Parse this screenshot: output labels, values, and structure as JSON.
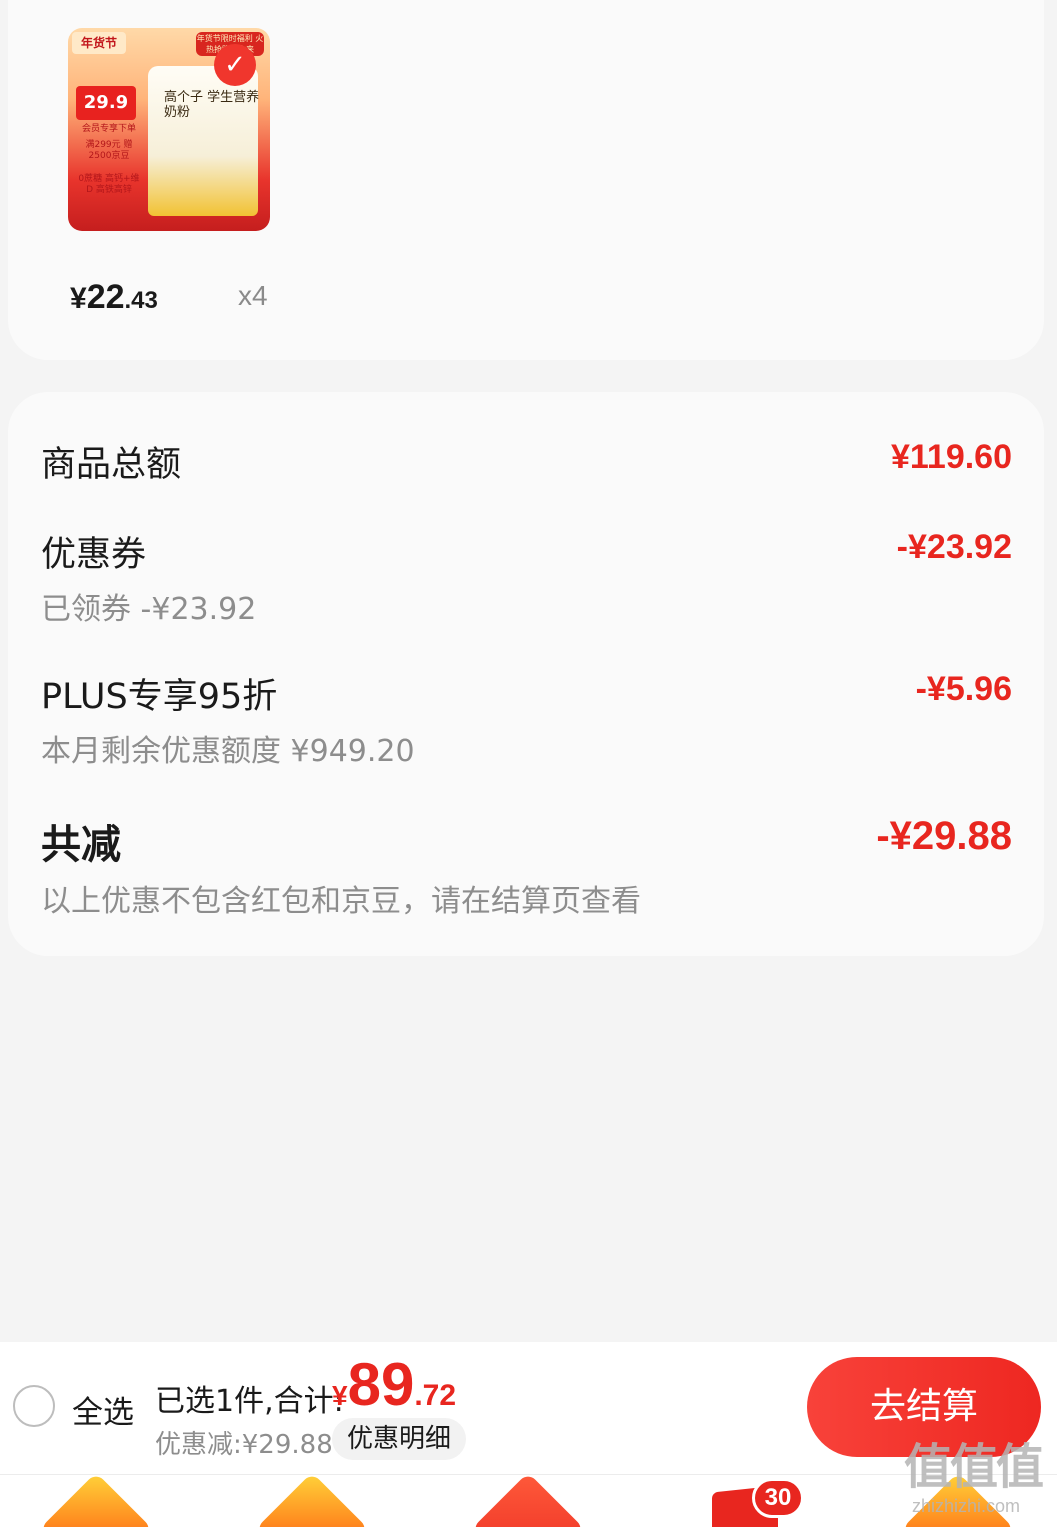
{
  "product": {
    "image_banner": "年货节限时福利 火热抢购等你来",
    "image_logo": "年货节",
    "image_price_tag": "29.9",
    "image_tag_member": "会员专享下单",
    "image_tag_beans": "满299元 赠2500京豆",
    "image_tag_features": "0蔗糖 高钙+维D 高铁高锌",
    "image_bag_title": "高个子 学生营养奶粉",
    "unit_price_symbol": "¥",
    "unit_price_int": "22",
    "unit_price_dec": ".43",
    "quantity": "x4"
  },
  "summary": {
    "goods_total_label": "商品总额",
    "goods_total_amount": "¥119.60",
    "coupon_label": "优惠券",
    "coupon_sub": "已领券 -¥23.92",
    "coupon_amount": "-¥23.92",
    "plus_label": "PLUS专享95折",
    "plus_sub": "本月剩余优惠额度 ¥949.20",
    "plus_amount": "-¥5.96",
    "total_reduce_label": "共减",
    "total_reduce_amount": "-¥29.88",
    "note": "以上优惠不包含红包和京豆，请在结算页查看"
  },
  "checkout": {
    "select_all_label": "全选",
    "selected_summary": "已选1件,合计:",
    "total_symbol": "¥",
    "total_int": "89",
    "total_dec": ".72",
    "discount_line": "优惠减:¥29.88",
    "discount_detail_label": "优惠明细",
    "checkout_label": "去结算"
  },
  "tab_bar": {
    "cart_badge": "30"
  },
  "watermark": {
    "big": "值值值",
    "small": "zhizhizhi.com"
  },
  "colors": {
    "accent": "#e8261f",
    "muted": "#8d8d8d",
    "card": "#fafafa",
    "background": "#f4f4f4"
  }
}
